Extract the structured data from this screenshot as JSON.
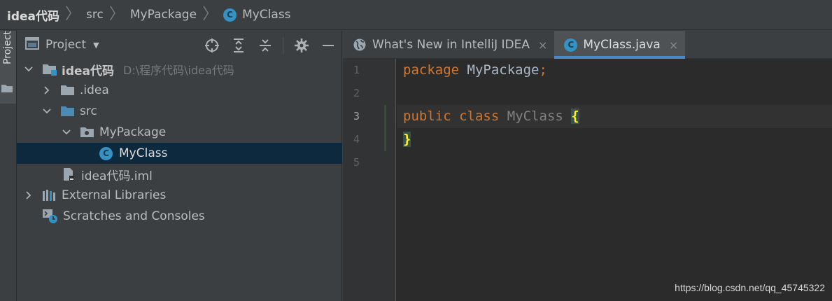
{
  "breadcrumb": {
    "project": "idea代码",
    "folder": "src",
    "package": "MyPackage",
    "class": "MyClass",
    "class_icon_letter": "C"
  },
  "stripe": {
    "label": "Project"
  },
  "project_panel": {
    "title": "Project",
    "tree": {
      "root_name": "idea代码",
      "root_path": "D:\\程序代码\\idea代码",
      "idea_folder": ".idea",
      "src_folder": "src",
      "package": "MyPackage",
      "class": "MyClass",
      "class_icon_letter": "C",
      "iml_file": "idea代码.iml",
      "external_libraries": "External Libraries",
      "scratches": "Scratches and Consoles"
    }
  },
  "editor": {
    "tabs": [
      {
        "label": "What's New in IntelliJ IDEA",
        "close": "×"
      },
      {
        "label": "MyClass.java",
        "close": "×",
        "icon_letter": "C"
      }
    ],
    "line_numbers": [
      "1",
      "2",
      "3",
      "4",
      "5"
    ],
    "code": {
      "line1_keyword": "package",
      "line1_name": "MyPackage",
      "line1_semi": ";",
      "line3_kw1": "public",
      "line3_kw2": "class",
      "line3_name": "MyClass",
      "line3_brace": "{",
      "line4_brace": "}"
    }
  },
  "watermark": "https://blog.csdn.net/qq_45745322",
  "colors": {
    "background": "#2b2b2b",
    "panel": "#3c3f41",
    "selection": "#0d293e",
    "accent": "#4a88c7",
    "keyword": "#cc7832",
    "brace": "#ffef28"
  }
}
